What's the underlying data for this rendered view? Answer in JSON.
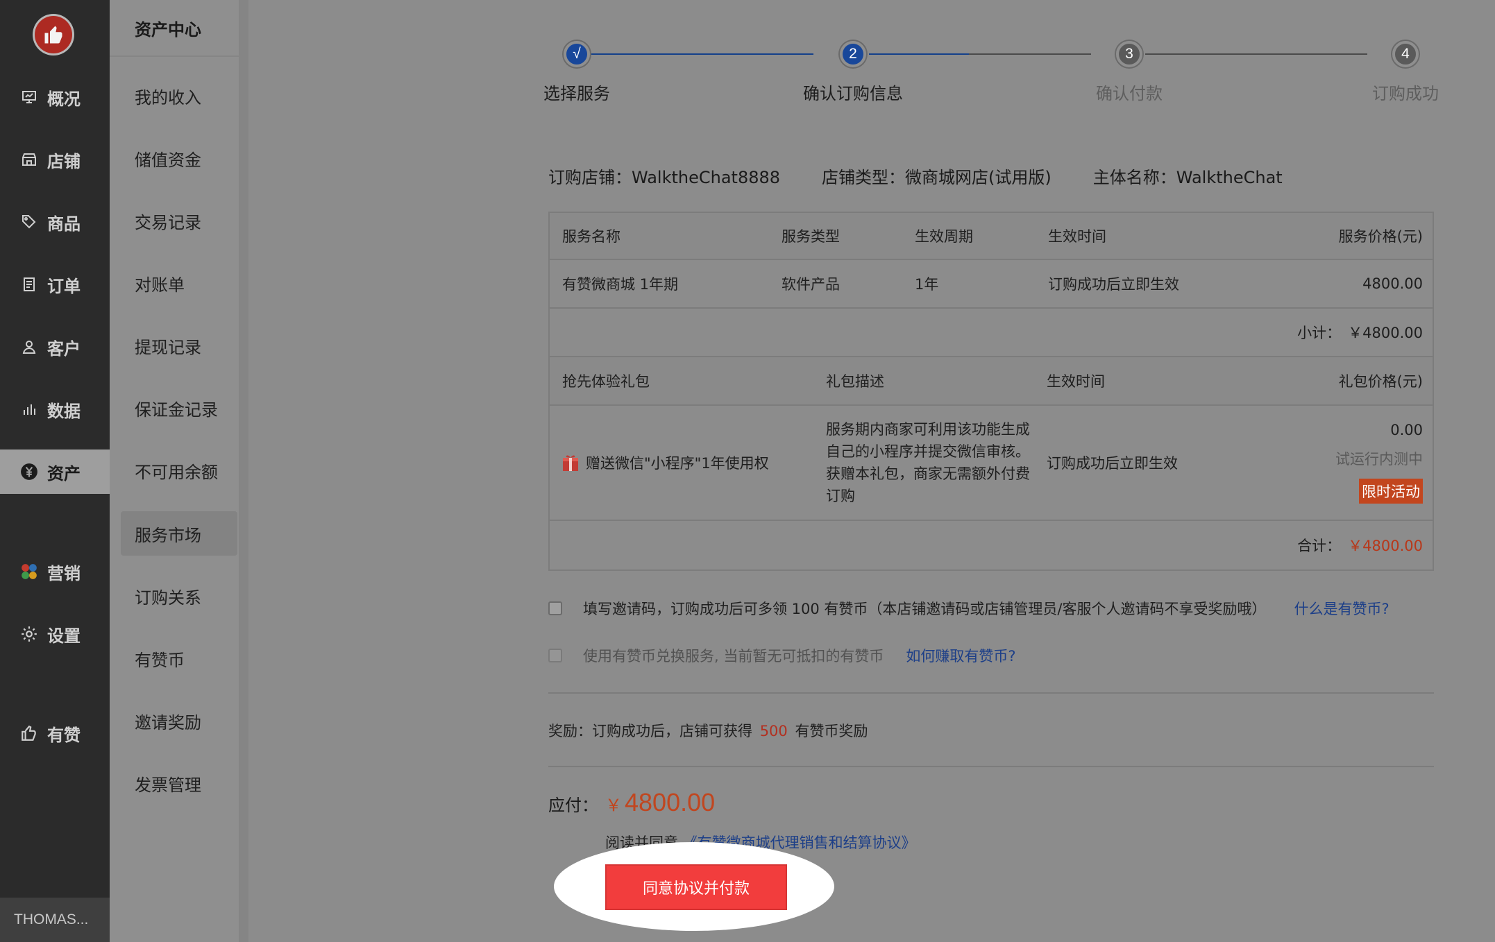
{
  "primary_nav": {
    "items": [
      {
        "label": "概况",
        "icon": "monitor-icon"
      },
      {
        "label": "店铺",
        "icon": "store-icon"
      },
      {
        "label": "商品",
        "icon": "tag-icon"
      },
      {
        "label": "订单",
        "icon": "document-icon"
      },
      {
        "label": "客户",
        "icon": "user-icon"
      },
      {
        "label": "数据",
        "icon": "bar-chart-icon"
      },
      {
        "label": "资产",
        "icon": "yuan-icon",
        "active": true
      },
      {
        "label": "营销",
        "icon": "apps-icon"
      },
      {
        "label": "设置",
        "icon": "gear-icon"
      },
      {
        "label": "有赞",
        "icon": "thumbs-up-icon"
      }
    ],
    "user": "THOMAS..."
  },
  "secondary_nav": {
    "title": "资产中心",
    "items": [
      "我的收入",
      "储值资金",
      "交易记录",
      "对账单",
      "提现记录",
      "保证金记录",
      "不可用余额",
      "服务市场",
      "订购关系",
      "有赞币",
      "邀请奖励",
      "发票管理"
    ],
    "active": "服务市场"
  },
  "stepper": {
    "steps": [
      {
        "num": "√",
        "label": "选择服务",
        "state": "done"
      },
      {
        "num": "2",
        "label": "确认订购信息",
        "state": "current"
      },
      {
        "num": "3",
        "label": "确认付款",
        "state": "todo"
      },
      {
        "num": "4",
        "label": "订购成功",
        "state": "todo"
      }
    ]
  },
  "order_info": {
    "store": "订购店铺：WalktheChat8888",
    "store_type": "店铺类型：微商城网店(试用版)",
    "entity": "主体名称：WalktheChat"
  },
  "service_table": {
    "headers": [
      "服务名称",
      "服务类型",
      "生效周期",
      "生效时间",
      "服务价格(元)"
    ],
    "row": [
      "有赞微商城 1年期",
      "软件产品",
      "1年",
      "订购成功后立即生效",
      "4800.00"
    ],
    "subtotal_label": "小计：",
    "subtotal_value": "￥4800.00"
  },
  "gift_table": {
    "headers": [
      "抢先体验礼包",
      "礼包描述",
      "生效时间",
      "礼包价格(元)"
    ],
    "name": "赠送微信\"小程序\"1年使用权",
    "desc": "服务期内商家可利用该功能生成自己的小程序并提交微信审核。获赠本礼包，商家无需额外付费订购",
    "effective": "订购成功后立即生效",
    "price": "0.00",
    "status": "试运行内测中",
    "tag": "限时活动",
    "total_label": "合计：",
    "total_value": "￥4800.00"
  },
  "options": {
    "invite_text": "填写邀请码，订购成功后可多领 100 有赞币（本店铺邀请码或店铺管理员/客服个人邀请码不享受奖励哦）",
    "invite_link": "什么是有赞币?",
    "coin_text": "使用有赞币兑换服务, 当前暂无可抵扣的有赞币",
    "coin_link": "如何赚取有赞币?"
  },
  "reward": {
    "prefix": "奖励：订购成功后，店铺可获得",
    "amount": "500",
    "suffix": "有赞币奖励"
  },
  "payment": {
    "label": "应付：",
    "currency": "￥",
    "amount": "4800.00",
    "agree_prefix": "阅读并同意",
    "agreement_link": "《有赞微商城代理销售和结算协议》",
    "button": "同意协议并付款"
  },
  "colors": {
    "accent_red": "#f23d3d",
    "price_orange": "#c1461f",
    "link_blue": "#1d3f88",
    "step_blue": "#18479a"
  }
}
